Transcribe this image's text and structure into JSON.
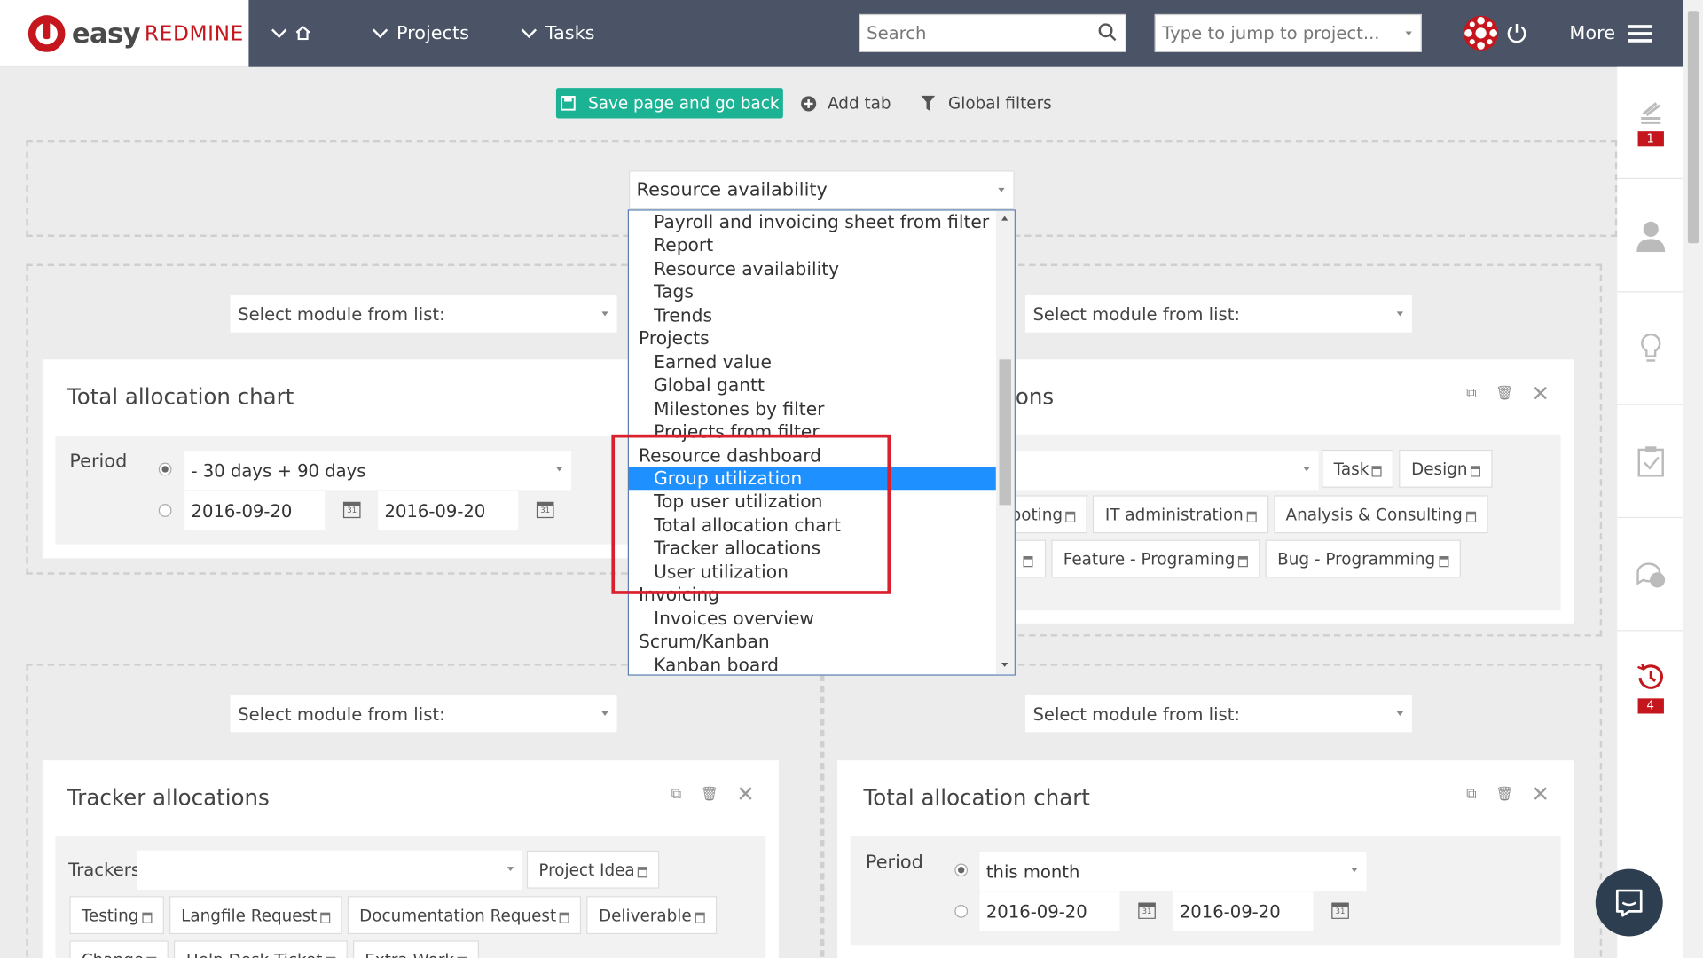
{
  "brand": {
    "logo_text": "easy",
    "logo_text2": "REDMINE"
  },
  "nav": {
    "home_icon": "home-icon",
    "projects": "Projects",
    "tasks": "Tasks",
    "more": "More"
  },
  "search": {
    "placeholder": "Search"
  },
  "jump": {
    "placeholder": "Type to jump to project..."
  },
  "toolbar": {
    "save_label": "Save page and go back",
    "add_tab": "Add tab",
    "global_filters": "Global filters"
  },
  "modules": {
    "top_select": "Resource availability",
    "select_prompt": "Select module from list:"
  },
  "dropdown": {
    "options": [
      {
        "label": "Payroll and invoicing sheet from filter",
        "kind": "item"
      },
      {
        "label": "Report",
        "kind": "item"
      },
      {
        "label": "Resource availability",
        "kind": "item"
      },
      {
        "label": "Tags",
        "kind": "item"
      },
      {
        "label": "Trends",
        "kind": "item"
      },
      {
        "label": "Projects",
        "kind": "grp"
      },
      {
        "label": "Earned value",
        "kind": "item"
      },
      {
        "label": "Global gantt",
        "kind": "item"
      },
      {
        "label": "Milestones by filter",
        "kind": "item"
      },
      {
        "label": "Projects from filter",
        "kind": "item"
      },
      {
        "label": "Resource dashboard",
        "kind": "grp"
      },
      {
        "label": "Group utilization",
        "kind": "item",
        "selected": true
      },
      {
        "label": "Top user utilization",
        "kind": "item"
      },
      {
        "label": "Total allocation chart",
        "kind": "item"
      },
      {
        "label": "Tracker allocations",
        "kind": "item"
      },
      {
        "label": "User utilization",
        "kind": "item"
      },
      {
        "label": "Invoicing",
        "kind": "grp"
      },
      {
        "label": "Invoices overview",
        "kind": "item"
      },
      {
        "label": "Scrum/Kanban",
        "kind": "grp"
      },
      {
        "label": "Kanban board",
        "kind": "item"
      }
    ]
  },
  "panel_tl": {
    "title": "Total allocation chart",
    "period_label": "Period",
    "period_value": "- 30 days + 90 days",
    "date_from": "2016-09-20",
    "date_to": "2016-09-20"
  },
  "panel_tr": {
    "title_fragment": "ons",
    "tags_row1": [
      "Task",
      "Design"
    ],
    "tags_row2": [
      "ooting",
      "IT administration",
      "Analysis & Consulting"
    ],
    "tags_row3": [
      "Feature - Programing",
      "Bug - Programming"
    ]
  },
  "panel_bl": {
    "title": "Tracker allocations",
    "trackers_label": "Trackers",
    "tags_row1": [
      "Project Idea"
    ],
    "tags_row2": [
      "Testing",
      "Langfile Request",
      "Documentation Request",
      "Deliverable"
    ],
    "tags_row3": [
      "Change",
      "Help Desk Ticket",
      "Extra Work"
    ]
  },
  "panel_br": {
    "title": "Total allocation chart",
    "period_label": "Period",
    "period_value": "this month",
    "date_from": "2016-09-20",
    "date_to": "2016-09-20"
  },
  "sidebar": {
    "badge_1": "1",
    "badge_2": "4"
  },
  "calendar_day": "31"
}
